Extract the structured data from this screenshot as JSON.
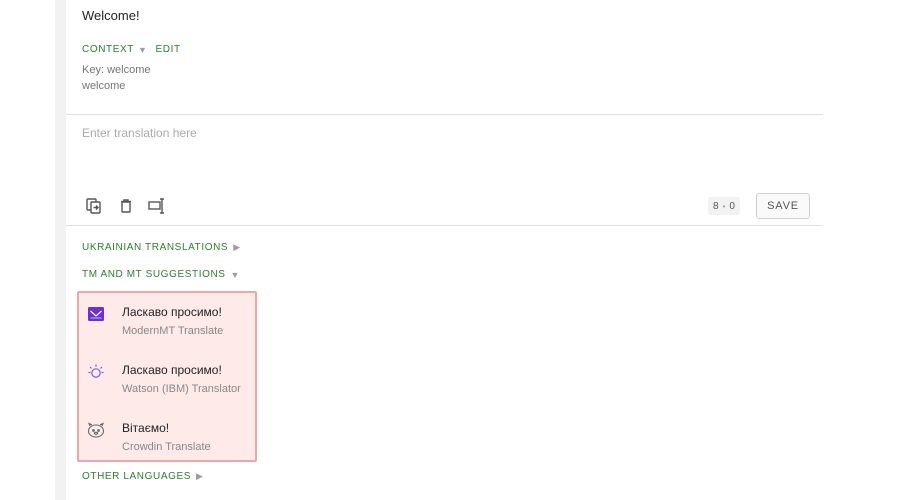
{
  "source": {
    "text": "Welcome!",
    "context_label": "CONTEXT",
    "edit_label": "EDIT",
    "key_line": "Key: welcome",
    "description": "welcome"
  },
  "editor": {
    "placeholder": "Enter translation here",
    "value": "",
    "counter_left": "8",
    "counter_right": "0",
    "save_label": "SAVE",
    "icons": [
      "copy-source-icon",
      "delete-icon",
      "text-selection-icon"
    ]
  },
  "sections": {
    "language_translations": "UKRAINIAN TRANSLATIONS",
    "suggestions": "TM AND MT SUGGESTIONS",
    "other_languages": "OTHER LANGUAGES"
  },
  "suggestions": [
    {
      "text": "Ласкаво просимо!",
      "engine": "ModernMT Translate",
      "icon": "modernmt-icon"
    },
    {
      "text": "Ласкаво просимо!",
      "engine": "Watson (IBM) Translator",
      "icon": "watson-icon"
    },
    {
      "text": "Вітаємо!",
      "engine": "Crowdin Translate",
      "icon": "crowdin-icon"
    }
  ],
  "colors": {
    "accent_green": "#2e7d32",
    "highlight_background": "#ffeaea",
    "highlight_border": "#f1a6a6",
    "modernmt_purple": "#6b2fd6"
  }
}
